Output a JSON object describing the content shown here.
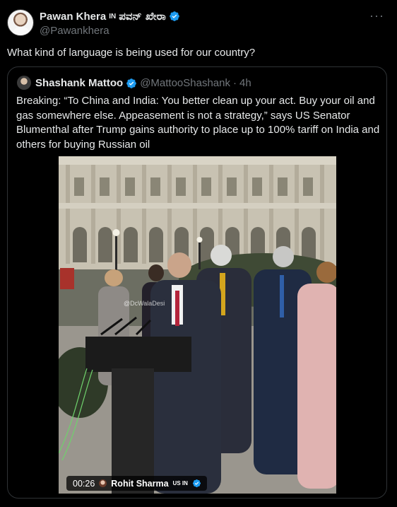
{
  "post": {
    "display_name": "Pawan Khera",
    "flag_label": "IN",
    "native_name": "ಪವನ್ ಖೇರಾ",
    "handle": "@Pawankhera",
    "more_label": "···",
    "text": "What kind of language is being used for our country?"
  },
  "quote": {
    "display_name": "Shashank Mattoo",
    "handle": "@MattooShashank",
    "separator": "·",
    "time": "4h",
    "text": "Breaking: “To China and India: You better clean up your act. Buy your oil and gas somewhere else. Appeasement is not a strategy,” says US Senator Blumenthal after Trump gains authority to place up to 100% tariff on India and others for buying Russian oil"
  },
  "video": {
    "watermark": "@DcWalaDesi",
    "duration": "00:26",
    "creator_name": "Rohit Sharma",
    "creator_flag": "US IN"
  },
  "colors": {
    "background": "#000000",
    "text": "#e7e9ea",
    "secondary_text": "#71767b",
    "border": "#2f3336",
    "verified": "#1d9bf0"
  },
  "icons": {
    "verified": "verified-badge-icon",
    "more": "more-options-icon"
  }
}
